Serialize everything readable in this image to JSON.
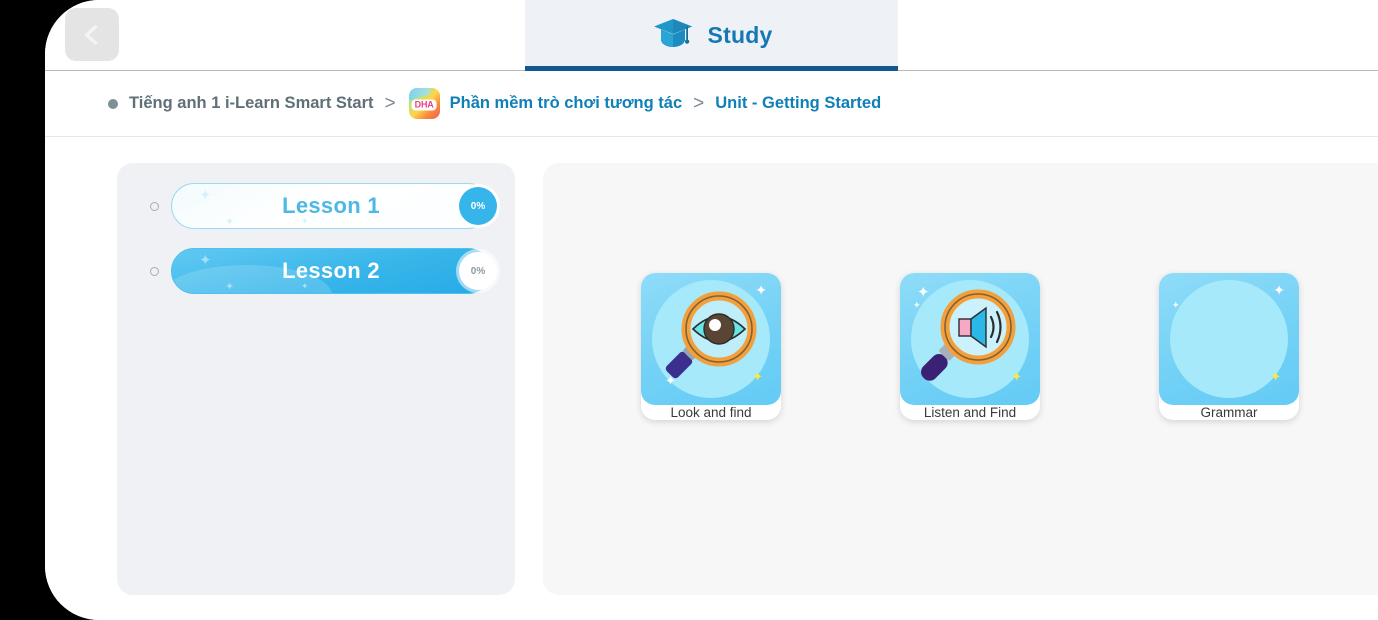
{
  "topbar": {
    "back_button_label": "Back",
    "back_icon": "chevron-left-icon"
  },
  "tabs": [
    {
      "label": "Study",
      "icon": "graduation-cap-icon",
      "active": true,
      "underline_color": "#11588f",
      "text_color": "#1478b4",
      "background": "#eef1f5"
    }
  ],
  "breadcrumb": {
    "dot_color": "#808e96",
    "separator": ">",
    "items": [
      {
        "label": "Tiếng anh 1 i-Learn Smart Start",
        "type": "text",
        "color": "#5f7076",
        "icon": null
      },
      {
        "label": "Phần mềm trò chơi tương tác",
        "type": "link",
        "color": "#0f7fb8",
        "icon": "dha-app-icon",
        "icon_text": "DHA"
      },
      {
        "label": "Unit - Getting Started",
        "type": "link",
        "color": "#0f7fb8",
        "icon": null
      }
    ]
  },
  "lesson_panel": {
    "background": "#eff1f5",
    "lessons": [
      {
        "title": "Lesson 1",
        "progress": "0%",
        "selected": false
      },
      {
        "title": "Lesson 2",
        "progress": "0%",
        "selected": true
      }
    ]
  },
  "activity_panel": {
    "background": "#f7f7f8",
    "cards": [
      {
        "label": "Look and find",
        "icon": "magnifier-eye-icon",
        "thumb_color": "#76d2f6"
      },
      {
        "label": "Listen and Find",
        "icon": "magnifier-speaker-icon",
        "thumb_color": "#76d2f6"
      },
      {
        "label": "Grammar",
        "icon": "placeholder-circle-icon",
        "thumb_color": "#76d2f6"
      }
    ]
  },
  "theme": {
    "accent_blue": "#35b5ea",
    "dark_blue": "#11588f",
    "link_blue": "#0f7fb8",
    "page_background": "#ffffff",
    "bezel": "#000000"
  }
}
